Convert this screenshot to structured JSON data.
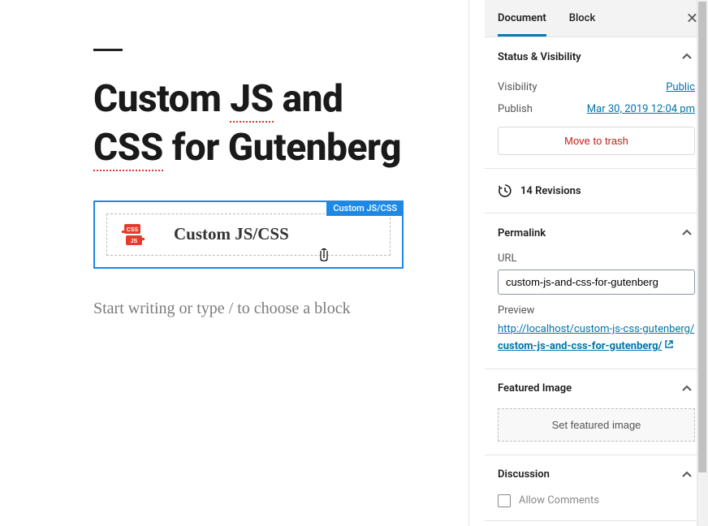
{
  "editor": {
    "title_parts": [
      "Custom ",
      "JS",
      " and ",
      "CSS",
      " for Gutenberg"
    ],
    "block": {
      "label": "Custom JS/CSS",
      "title": "Custom JS/CSS"
    },
    "placeholder": "Start writing or type / to choose a block"
  },
  "sidebar": {
    "tabs": {
      "document": "Document",
      "block": "Block"
    },
    "status": {
      "heading": "Status & Visibility",
      "visibility_label": "Visibility",
      "visibility_value": "Public",
      "publish_label": "Publish",
      "publish_value": "Mar 30, 2019 12:04 pm",
      "trash": "Move to trash"
    },
    "revisions": {
      "count": "14 Revisions"
    },
    "permalink": {
      "heading": "Permalink",
      "url_label": "URL",
      "url_value": "custom-js-and-css-for-gutenberg",
      "preview_label": "Preview",
      "preview_base": "http://localhost/custom-js-css-gutenberg/",
      "preview_slug": "custom-js-and-css-for-gutenberg/"
    },
    "featured": {
      "heading": "Featured Image",
      "button": "Set featured image"
    },
    "discussion": {
      "heading": "Discussion",
      "allow": "Allow Comments"
    }
  }
}
